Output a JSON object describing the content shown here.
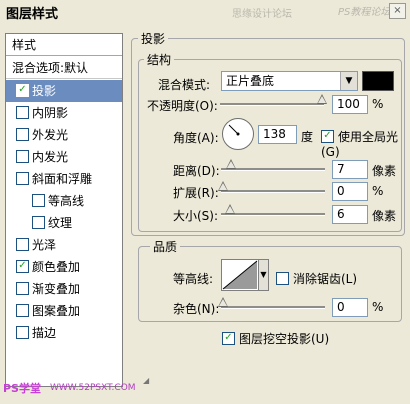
{
  "window": {
    "title": "图层样式",
    "watermark": "思缘设计论坛",
    "logo": "PS教程论坛",
    "close_glyph": "×"
  },
  "style_list": {
    "header": "样式",
    "blend_options": "混合选项:默认",
    "items": [
      {
        "label": "投影",
        "checked": true,
        "selected": true,
        "indent": false
      },
      {
        "label": "内阴影",
        "checked": false,
        "selected": false,
        "indent": false
      },
      {
        "label": "外发光",
        "checked": false,
        "selected": false,
        "indent": false
      },
      {
        "label": "内发光",
        "checked": false,
        "selected": false,
        "indent": false
      },
      {
        "label": "斜面和浮雕",
        "checked": false,
        "selected": false,
        "indent": false
      },
      {
        "label": "等高线",
        "checked": false,
        "selected": false,
        "indent": true
      },
      {
        "label": "纹理",
        "checked": false,
        "selected": false,
        "indent": true
      },
      {
        "label": "光泽",
        "checked": false,
        "selected": false,
        "indent": false
      },
      {
        "label": "颜色叠加",
        "checked": true,
        "selected": false,
        "indent": false
      },
      {
        "label": "渐变叠加",
        "checked": false,
        "selected": false,
        "indent": false
      },
      {
        "label": "图案叠加",
        "checked": false,
        "selected": false,
        "indent": false
      },
      {
        "label": "描边",
        "checked": false,
        "selected": false,
        "indent": false
      }
    ]
  },
  "drop_shadow": {
    "section_title": "投影",
    "structure": {
      "title": "结构",
      "blend_mode_label": "混合模式:",
      "blend_mode_value": "正片叠底",
      "shadow_color": "#000000",
      "opacity_label": "不透明度(O):",
      "opacity_value": "100",
      "opacity_unit": "%",
      "angle_label": "角度(A):",
      "angle_value": "138",
      "angle_unit": "度",
      "global_light_label": "使用全局光(G)",
      "global_light_checked": true,
      "distance_label": "距离(D):",
      "distance_value": "7",
      "distance_unit": "像素",
      "spread_label": "扩展(R):",
      "spread_value": "0",
      "spread_unit": "%",
      "size_label": "大小(S):",
      "size_value": "6",
      "size_unit": "像素"
    },
    "quality": {
      "title": "品质",
      "contour_label": "等高线:",
      "anti_aliased_label": "消除锯齿(L)",
      "anti_aliased_checked": false,
      "noise_label": "杂色(N):",
      "noise_value": "0",
      "noise_unit": "%"
    },
    "knockout_label": "图层挖空投影(U)",
    "knockout_checked": true
  },
  "footer": {
    "watermark": "PS学堂",
    "url": "WWW.52PSXT.COM"
  }
}
